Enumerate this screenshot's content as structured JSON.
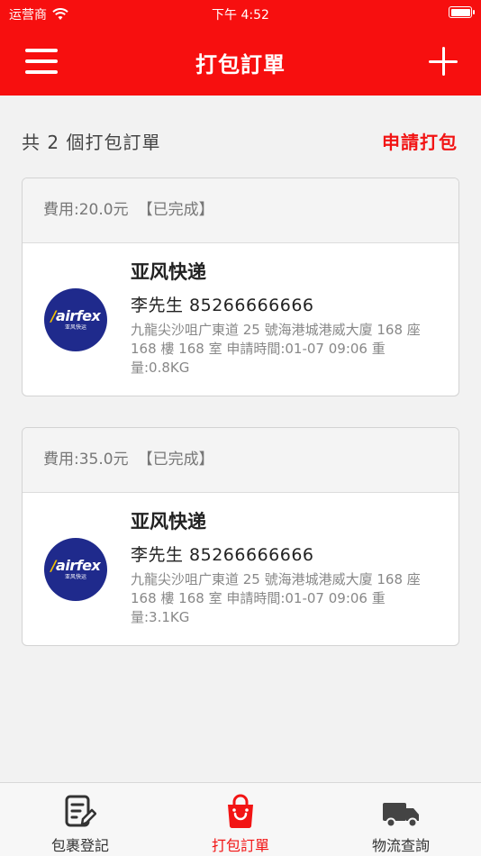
{
  "status_bar": {
    "carrier": "运营商",
    "time": "下午 4:52"
  },
  "nav": {
    "title": "打包訂單",
    "menu_icon": "hamburger-icon",
    "add_icon": "plus-icon"
  },
  "summary": {
    "count_text": "共 2 個打包訂單",
    "apply_label": "申請打包"
  },
  "orders": [
    {
      "fee": "費用:20.0元",
      "status": "【已完成】",
      "company": "亚风快递",
      "logo_text": "airfex",
      "logo_sub": "亚风快运",
      "contact": "李先生 85266666666",
      "detail": "九龍尖沙咀广東道 25 號海港城港威大廈 168 座 168 樓 168 室 申請時間:01-07 09:06 重量:0.8KG"
    },
    {
      "fee": "費用:35.0元",
      "status": "【已完成】",
      "company": "亚风快递",
      "logo_text": "airfex",
      "logo_sub": "亚风快运",
      "contact": "李先生 85266666666",
      "detail": "九龍尖沙咀广東道 25 號海港城港威大廈 168 座 168 樓 168 室 申請時間:01-07 09:06 重量:3.1KG"
    }
  ],
  "tabs": [
    {
      "label": "包裹登記",
      "icon": "document-edit-icon",
      "active": false
    },
    {
      "label": "打包訂單",
      "icon": "shopping-bag-icon",
      "active": true
    },
    {
      "label": "物流查詢",
      "icon": "truck-icon",
      "active": false
    }
  ],
  "colors": {
    "brand_red": "#f70f0f",
    "active_tab": "#f21414",
    "logo_blue": "#1f2a8c"
  }
}
